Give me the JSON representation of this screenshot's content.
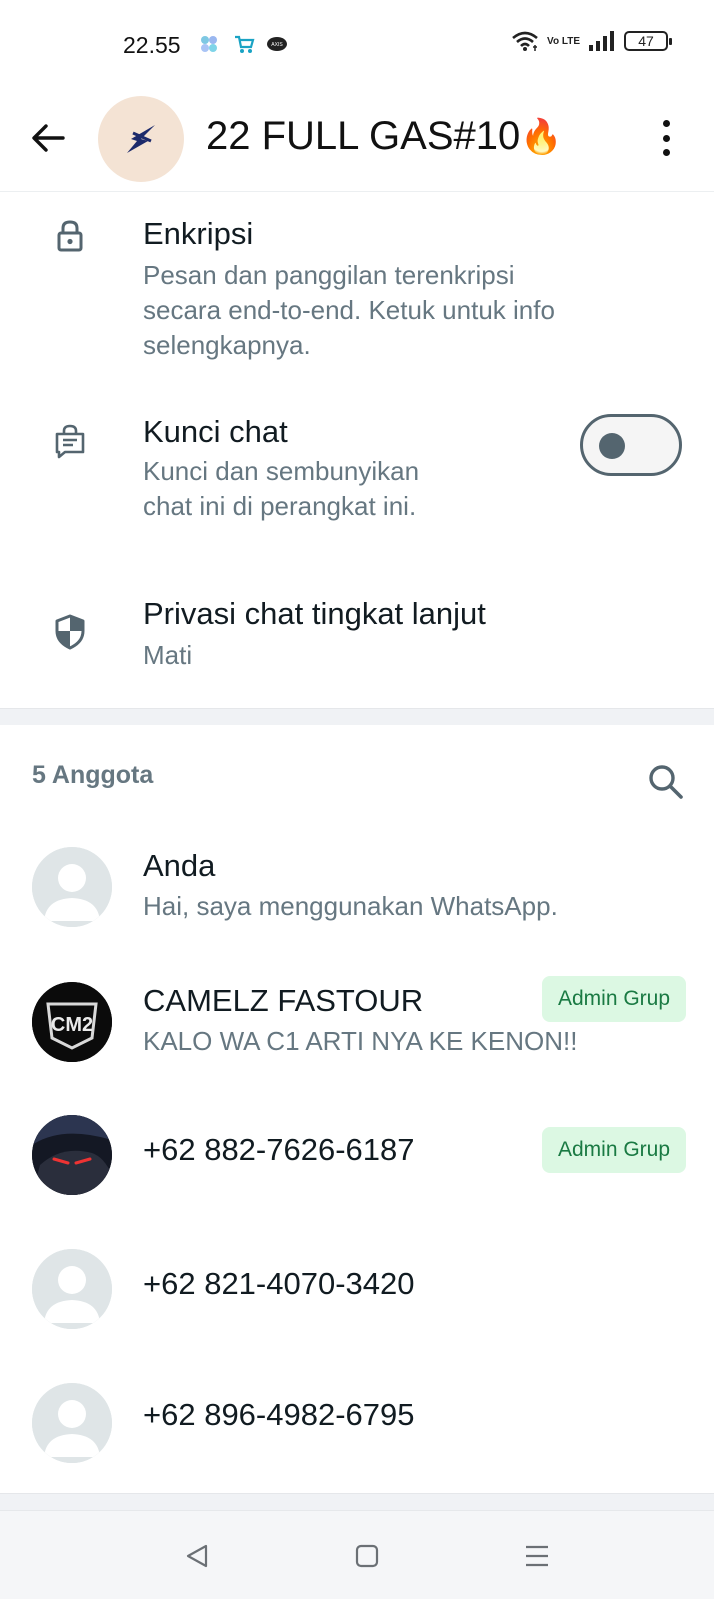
{
  "status_bar": {
    "time": "22.55",
    "network": "Vo LTE",
    "battery": "47"
  },
  "header": {
    "title": "22 FULL GAS#10",
    "title_emoji": "🔥"
  },
  "settings": {
    "encryption": {
      "title": "Enkripsi",
      "description": "Pesan dan panggilan terenkripsi\nsecara end-to-end. Ketuk untuk info\nselengkapnya."
    },
    "chat_lock": {
      "title": "Kunci chat",
      "description": "Kunci dan sembunyikan\nchat ini di perangkat ini.",
      "enabled": false
    },
    "advanced_privacy": {
      "title": "Privasi chat tingkat lanjut",
      "status": "Mati"
    }
  },
  "members": {
    "count_label": "5 Anggota",
    "items": [
      {
        "name": "Anda",
        "about": "Hai, saya menggunakan WhatsApp.",
        "badge": ""
      },
      {
        "name": "CAMELZ FASTOUR",
        "about": "KALO WA C1 ARTI NYA KE KENON!!",
        "badge": "Admin Grup",
        "avatar_text": "CM2"
      },
      {
        "name": "+62 882-7626-6187",
        "about": "",
        "badge": "Admin Grup"
      },
      {
        "name": "+62 821-4070-3420",
        "about": "",
        "badge": ""
      },
      {
        "name": "+62 896-4982-6795",
        "about": "",
        "badge": ""
      }
    ]
  },
  "colors": {
    "accent_green_bg": "#dcf8e3",
    "accent_green_text": "#1a7a43",
    "secondary_text": "#667781",
    "primary_text": "#111b21"
  }
}
